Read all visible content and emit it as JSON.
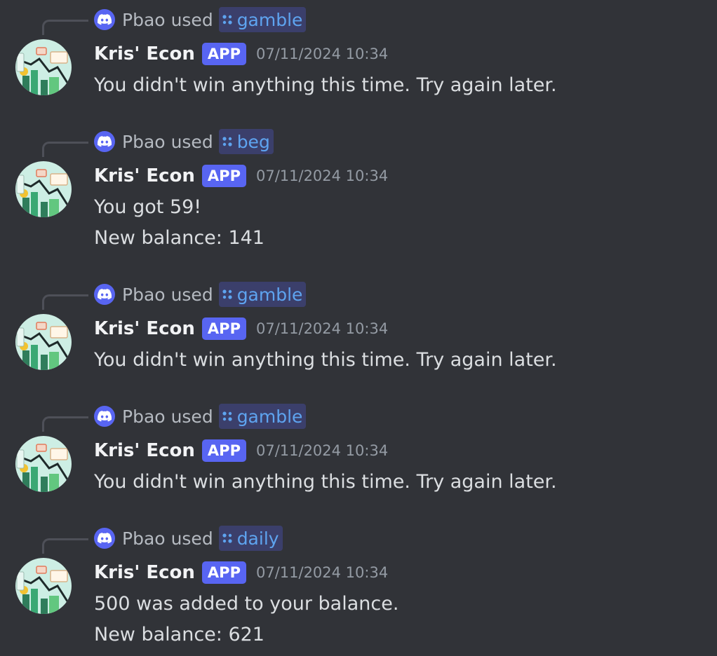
{
  "bot": {
    "name": "Kris' Econ",
    "tag": "APP",
    "avatar_icon": "econ-chart-avatar-icon"
  },
  "user": {
    "name": "Pbao",
    "used_text": "used"
  },
  "colors": {
    "background": "#313338",
    "blurple": "#5865f2",
    "command_text": "#5ea4f0",
    "command_bg": "#3b3f6b"
  },
  "messages": [
    {
      "command": "gamble",
      "timestamp": "07/11/2024 10:34",
      "lines": [
        "You didn't win anything this time. Try again later."
      ]
    },
    {
      "command": "beg",
      "timestamp": "07/11/2024 10:34",
      "lines": [
        "You got 59!",
        "New balance: 141"
      ]
    },
    {
      "command": "gamble",
      "timestamp": "07/11/2024 10:34",
      "lines": [
        "You didn't win anything this time. Try again later."
      ]
    },
    {
      "command": "gamble",
      "timestamp": "07/11/2024 10:34",
      "lines": [
        "You didn't win anything this time. Try again later."
      ]
    },
    {
      "command": "daily",
      "timestamp": "07/11/2024 10:34",
      "lines": [
        "500 was added to your balance.",
        "New balance: 621"
      ]
    }
  ]
}
